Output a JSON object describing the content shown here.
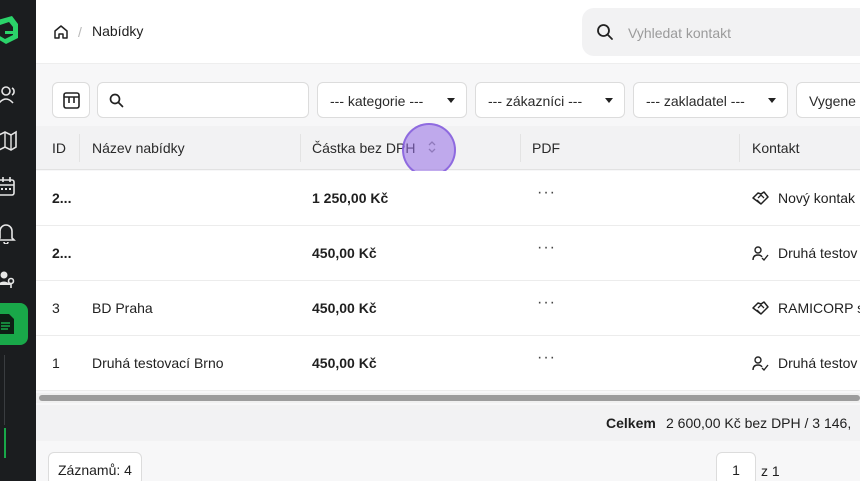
{
  "header": {
    "breadcrumb_current": "Nabídky",
    "breadcrumb_separator": "/",
    "search_placeholder": "Vyhledat kontakt"
  },
  "filters": {
    "search_value": "",
    "category": "--- kategorie ---",
    "customers": "--- zákazníci ---",
    "founder": "--- zakladatel ---",
    "generated": "Vygene"
  },
  "table": {
    "columns": [
      "ID",
      "Název nabídky",
      "Částka bez DPH",
      "PDF",
      "Kontakt"
    ],
    "rows": [
      {
        "id": "2...",
        "name": "",
        "amount": "1 250,00 Kč",
        "pdf": "···",
        "contact": "Nový kontak",
        "contact_icon": "handshake-icon"
      },
      {
        "id": "2...",
        "name": "",
        "amount": "450,00 Kč",
        "pdf": "···",
        "contact": "Druhá testov",
        "contact_icon": "user-check-icon"
      },
      {
        "id": "3",
        "name": "BD Praha",
        "amount": "450,00 Kč",
        "pdf": "···",
        "contact": "RAMICORP s",
        "contact_icon": "handshake-icon"
      },
      {
        "id": "1",
        "name": "Druhá testovací Brno",
        "amount": "450,00 Kč",
        "pdf": "···",
        "contact": "Druhá testov",
        "contact_icon": "user-check-icon"
      }
    ]
  },
  "totals": {
    "label": "Celkem",
    "value": "2 600,00 Kč bez DPH / 3 146,"
  },
  "footer": {
    "records": "Záznamů: 4",
    "page": "1",
    "page_of": "z 1"
  },
  "colors": {
    "accent_green": "#19a849",
    "sidebar_bg": "#1b1d1f",
    "sort_highlight": "#9a6ee6"
  }
}
